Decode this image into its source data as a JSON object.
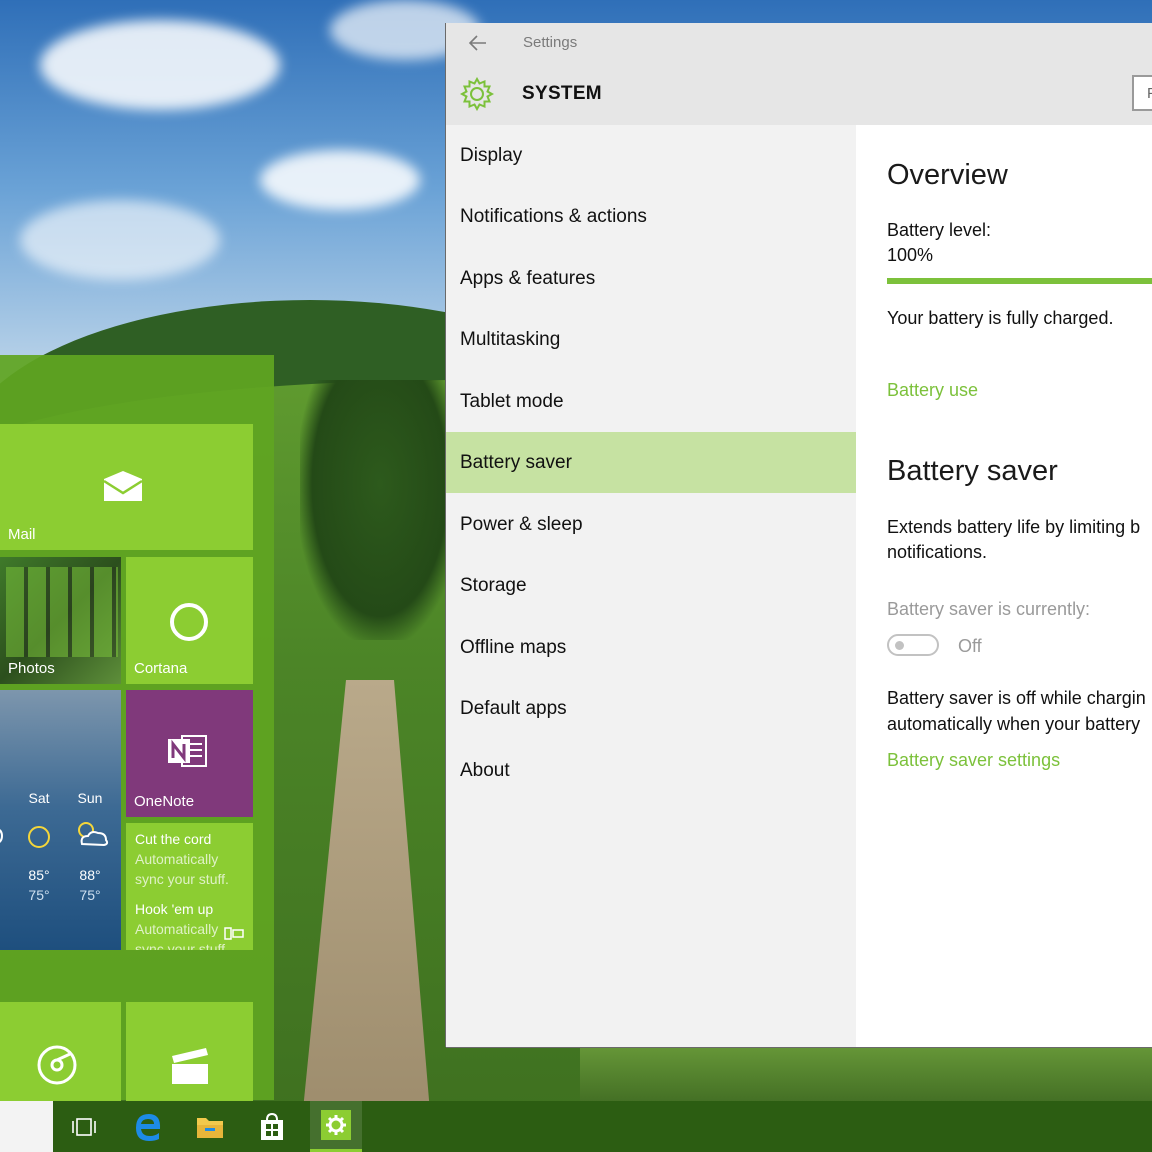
{
  "window": {
    "title": "Settings",
    "section": "SYSTEM",
    "search_placeholder": "F"
  },
  "nav": {
    "items": [
      {
        "label": "Display"
      },
      {
        "label": "Notifications & actions"
      },
      {
        "label": "Apps & features"
      },
      {
        "label": "Multitasking"
      },
      {
        "label": "Tablet mode"
      },
      {
        "label": "Battery saver",
        "selected": true
      },
      {
        "label": "Power & sleep"
      },
      {
        "label": "Storage"
      },
      {
        "label": "Offline maps"
      },
      {
        "label": "Default apps"
      },
      {
        "label": "About"
      }
    ]
  },
  "content": {
    "overview_heading": "Overview",
    "battery_level_label": "Battery level:",
    "battery_level_value": "100%",
    "battery_level_fraction": 1.0,
    "battery_status": "Your battery is fully charged.",
    "battery_use_link": "Battery use",
    "battery_saver_heading": "Battery saver",
    "battery_saver_desc_line1": "Extends battery life by limiting b",
    "battery_saver_desc_line2": "notifications.",
    "currently_label": "Battery saver is currently:",
    "toggle_state": "Off",
    "info_line1": "Battery saver is off while chargin",
    "info_line2": "automatically when your battery",
    "settings_link": "Battery saver settings"
  },
  "start_menu": {
    "tiles": {
      "mail": "Mail",
      "photos": "Photos",
      "cortana": "Cortana",
      "onenote": "OneNote",
      "weather": {
        "days": [
          "Sat",
          "Sun"
        ],
        "highs": [
          "85°",
          "88°"
        ],
        "lows": [
          "75°",
          "75°"
        ]
      },
      "cut_the_cord": {
        "title1": "Cut the cord",
        "body1a": "Automatically",
        "body1b": "sync your stuff.",
        "title2": "Hook 'em up",
        "body2a": "Automatically",
        "body2b": "sync your stuff"
      }
    }
  },
  "colors": {
    "accent": "#7cc13b",
    "selected_nav": "#c6e2a2",
    "tile_green": "#8ccd32",
    "onenote_purple": "#80397b",
    "taskbar": "#2c5d12"
  }
}
